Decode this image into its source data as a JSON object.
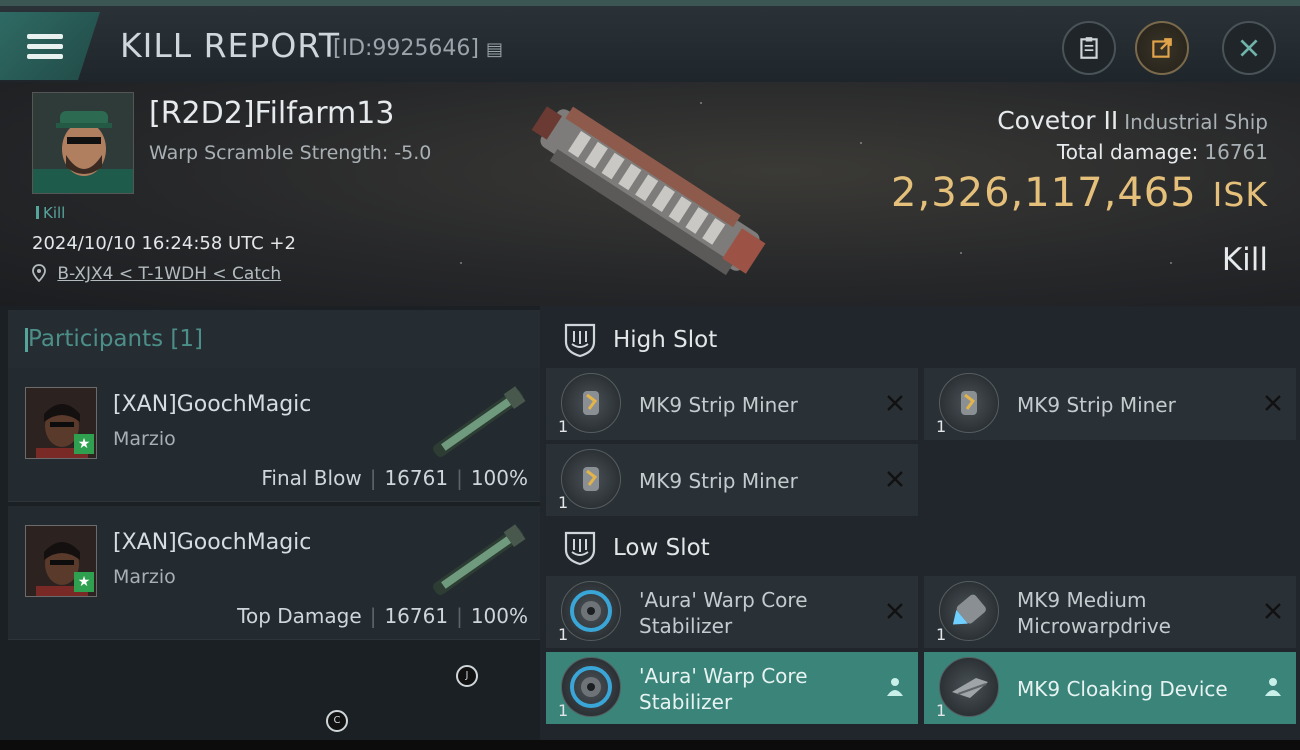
{
  "header": {
    "title": "KILL REPORT",
    "id_text": "[ID:9925646]",
    "buttons": [
      "clipboard-icon",
      "share-icon",
      "close-icon"
    ]
  },
  "victim": {
    "name": "[R2D2]Filfarm13",
    "warp": "Warp Scramble Strength: -5.0",
    "tag": "Kill",
    "datetime": "2024/10/10 16:24:58 UTC +2",
    "location": "B-XJX4 < T-1WDH < Catch",
    "ship_name": "Covetor II",
    "ship_class": "Industrial Ship",
    "damage_label": "Total damage:",
    "damage_value": "16761",
    "isk_value": "2,326,117,465",
    "isk_unit": "ISK",
    "result": "Kill"
  },
  "participants": {
    "label": "Participants [1]",
    "items": [
      {
        "name": "[XAN]GoochMagic",
        "corp": "Marzio",
        "role": "Final Blow",
        "damage": "16761",
        "percent": "100%"
      },
      {
        "name": "[XAN]GoochMagic",
        "corp": "Marzio",
        "role": "Top Damage",
        "damage": "16761",
        "percent": "100%"
      }
    ]
  },
  "fitting": {
    "high_label": "High Slot",
    "low_label": "Low Slot",
    "high": [
      {
        "name": "MK9 Strip Miner",
        "qty": "1",
        "status": "destroyed"
      },
      {
        "name": "MK9 Strip Miner",
        "qty": "1",
        "status": "destroyed"
      },
      {
        "name": "MK9 Strip Miner",
        "qty": "1",
        "status": "destroyed"
      }
    ],
    "low": [
      {
        "name": "'Aura' Warp Core Stabilizer",
        "qty": "1",
        "status": "destroyed"
      },
      {
        "name": "MK9 Medium Microwarpdrive",
        "qty": "1",
        "status": "destroyed"
      },
      {
        "name": "'Aura' Warp Core Stabilizer",
        "qty": "1",
        "status": "dropped"
      },
      {
        "name": "MK9 Cloaking Device",
        "qty": "1",
        "status": "dropped"
      }
    ]
  },
  "markers": [
    "J",
    "C"
  ]
}
